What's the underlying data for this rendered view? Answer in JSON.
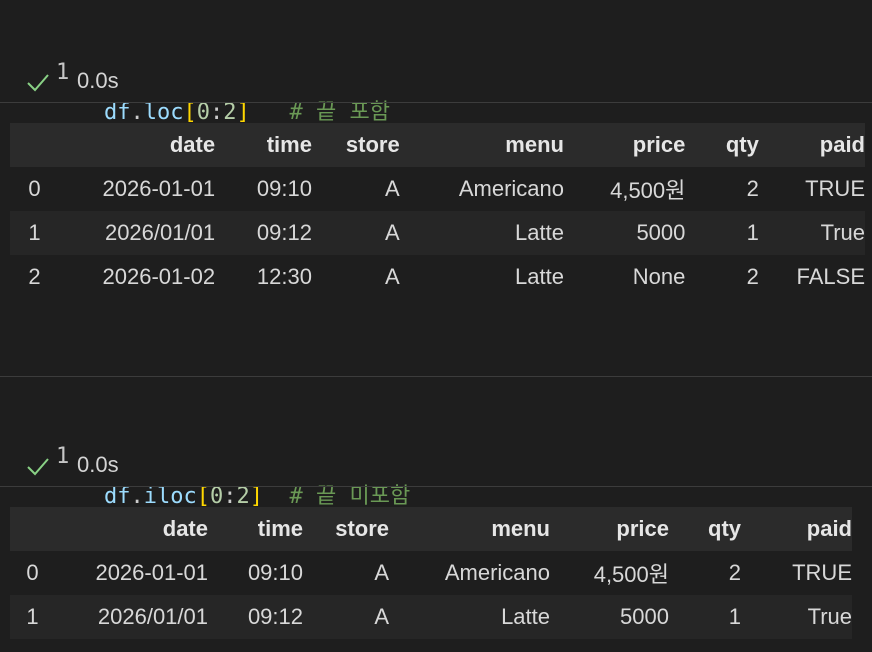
{
  "cells": [
    {
      "line_number": "1",
      "code": {
        "var": "df",
        "dot": ".",
        "method": "loc",
        "open": "[",
        "start": "0",
        "colon": ":",
        "end": "2",
        "close": "]",
        "comment": "# 끝 포함"
      },
      "status": {
        "icon": "check-icon",
        "time": "0.0s"
      },
      "table": {
        "columns": [
          "date",
          "time",
          "store",
          "menu",
          "price",
          "qty",
          "paid"
        ],
        "rows": [
          {
            "index": "0",
            "values": [
              "2026-01-01",
              "09:10",
              "A",
              "Americano",
              "4,500원",
              "2",
              "TRUE"
            ]
          },
          {
            "index": "1",
            "values": [
              "2026/01/01",
              "09:12",
              "A",
              "Latte",
              "5000",
              "1",
              "True"
            ]
          },
          {
            "index": "2",
            "values": [
              "2026-01-02",
              "12:30",
              "A",
              "Latte",
              "None",
              "2",
              "FALSE"
            ]
          }
        ]
      }
    },
    {
      "line_number": "1",
      "code": {
        "var": "df",
        "dot": ".",
        "method": "iloc",
        "open": "[",
        "start": "0",
        "colon": ":",
        "end": "2",
        "close": "]",
        "comment": "# 끝 미포함"
      },
      "status": {
        "icon": "check-icon",
        "time": "0.0s"
      },
      "table": {
        "columns": [
          "date",
          "time",
          "store",
          "menu",
          "price",
          "qty",
          "paid"
        ],
        "rows": [
          {
            "index": "0",
            "values": [
              "2026-01-01",
              "09:10",
              "A",
              "Americano",
              "4,500원",
              "2",
              "TRUE"
            ]
          },
          {
            "index": "1",
            "values": [
              "2026/01/01",
              "09:12",
              "A",
              "Latte",
              "5000",
              "1",
              "True"
            ]
          }
        ]
      }
    }
  ],
  "colors": {
    "background": "#1e1e1e",
    "check": "#89d185",
    "variable": "#9cdcfe",
    "bracket": "#ffd700",
    "number": "#b5cea8",
    "comment": "#6a9955"
  }
}
